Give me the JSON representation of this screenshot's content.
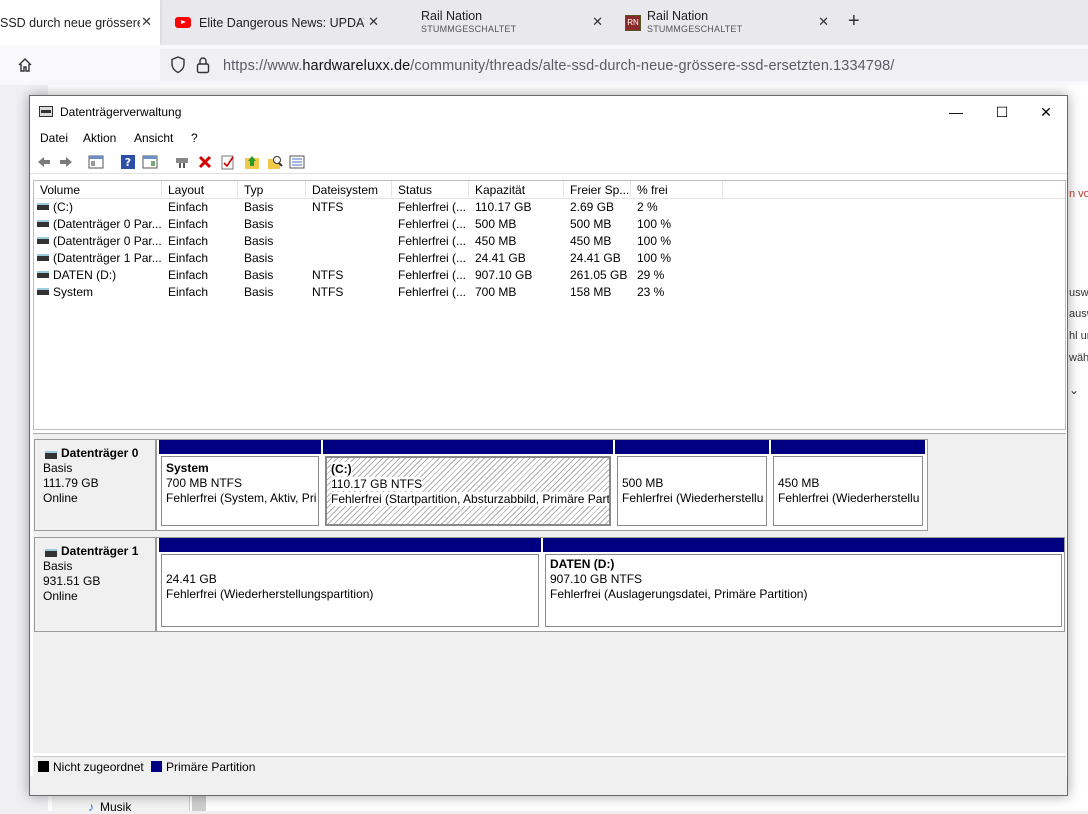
{
  "browser": {
    "tabs": [
      {
        "title": "SSD durch neue grössere SSD",
        "close": "✕"
      },
      {
        "title": "Elite Dangerous News: UPDATE",
        "close": "✕"
      },
      {
        "title": "Rail Nation",
        "subtitle": "STUMMGESCHALTET",
        "close": "✕"
      },
      {
        "title": "Rail Nation",
        "subtitle": "STUMMGESCHALTET",
        "close": "✕"
      }
    ],
    "new_tab": "+",
    "url_prefix": "https://www.",
    "url_domain": "hardwareluxx.de",
    "url_path": "/community/threads/alte-ssd-durch-neue-grössere-ssd-ersetzten.1334798/"
  },
  "page_bg": {
    "right_strip": [
      "n vo",
      "uswä",
      "auswä",
      "hl un",
      "wähl"
    ],
    "sidebar_item": "Musik"
  },
  "dialog": {
    "title": "Datenträgerverwaltung",
    "controls": {
      "minimize": "—",
      "maximize": "☐",
      "close": "✕"
    },
    "menu": [
      "Datei",
      "Aktion",
      "Ansicht",
      "?"
    ],
    "columns": [
      "Volume",
      "Layout",
      "Typ",
      "Dateisystem",
      "Status",
      "Kapazität",
      "Freier Sp...",
      "% frei"
    ],
    "volumes": [
      [
        "(C:)",
        "Einfach",
        "Basis",
        "NTFS",
        "Fehlerfrei (...",
        "110.17 GB",
        "2.69 GB",
        "2 %"
      ],
      [
        "(Datenträger 0 Par...",
        "Einfach",
        "Basis",
        "",
        "Fehlerfrei (...",
        "500 MB",
        "500 MB",
        "100 %"
      ],
      [
        "(Datenträger 0 Par...",
        "Einfach",
        "Basis",
        "",
        "Fehlerfrei (...",
        "450 MB",
        "450 MB",
        "100 %"
      ],
      [
        "(Datenträger 1 Par...",
        "Einfach",
        "Basis",
        "",
        "Fehlerfrei (...",
        "24.41 GB",
        "24.41 GB",
        "100 %"
      ],
      [
        "DATEN (D:)",
        "Einfach",
        "Basis",
        "NTFS",
        "Fehlerfrei (...",
        "907.10 GB",
        "261.05 GB",
        "29 %"
      ],
      [
        "System",
        "Einfach",
        "Basis",
        "NTFS",
        "Fehlerfrei (...",
        "700 MB",
        "158 MB",
        "23 %"
      ]
    ],
    "disks": [
      {
        "name": "Datenträger 0",
        "type": "Basis",
        "size": "111.79 GB",
        "state": "Online",
        "partitions": [
          {
            "name": "System",
            "size": "700 MB NTFS",
            "status": "Fehlerfrei (System, Aktiv, Pri"
          },
          {
            "name": "(C:)",
            "size": "110.17 GB NTFS",
            "status": "Fehlerfrei (Startpartition, Absturzabbild, Primäre Part"
          },
          {
            "name": "",
            "size": "500 MB",
            "status": "Fehlerfrei (Wiederherstellu"
          },
          {
            "name": "",
            "size": "450 MB",
            "status": "Fehlerfrei (Wiederherstellu"
          }
        ]
      },
      {
        "name": "Datenträger 1",
        "type": "Basis",
        "size": "931.51 GB",
        "state": "Online",
        "partitions": [
          {
            "name": "",
            "size": "24.41 GB",
            "status": "Fehlerfrei (Wiederherstellungspartition)"
          },
          {
            "name": "DATEN  (D:)",
            "size": "907.10 GB NTFS",
            "status": "Fehlerfrei (Auslagerungsdatei, Primäre Partition)"
          }
        ]
      }
    ],
    "legend": [
      {
        "label": "Nicht zugeordnet",
        "color": "#000000"
      },
      {
        "label": "Primäre Partition",
        "color": "#000080"
      }
    ],
    "toolbar_icons": [
      "back-icon",
      "forward-icon",
      "console-tree-icon",
      "help-icon",
      "properties-view-icon",
      "connect-icon",
      "delete-icon",
      "check-icon",
      "up-folder-icon",
      "search-folder-icon",
      "list-view-icon"
    ]
  }
}
